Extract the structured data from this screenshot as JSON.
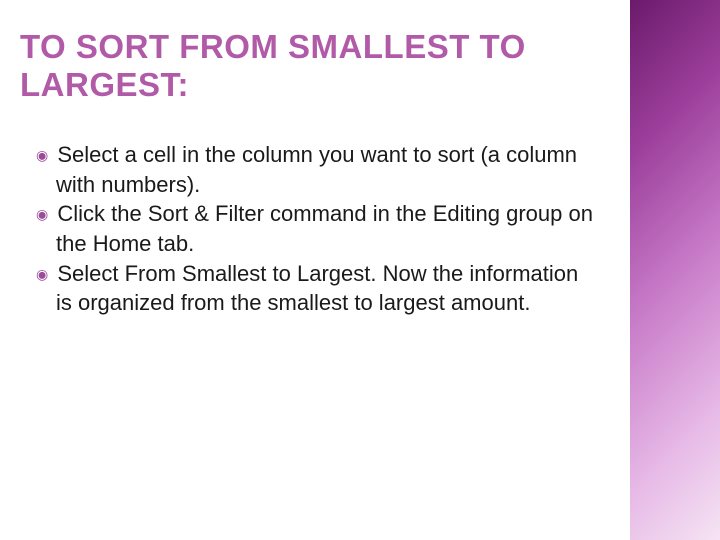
{
  "title": "TO SORT FROM SMALLEST TO LARGEST:",
  "bullets": [
    "Select a cell in the column you want to sort (a column with numbers).",
    "Click the Sort & Filter command in the Editing group on the Home tab.",
    "Select From Smallest to Largest. Now the information is organized from the smallest to largest amount."
  ],
  "bullet_glyph": "◉",
  "colors": {
    "title": "#b15aa8",
    "bullet_mark": "#9a4c9a",
    "accent_start": "#6b1a6b",
    "accent_end": "#f5e4f3"
  }
}
